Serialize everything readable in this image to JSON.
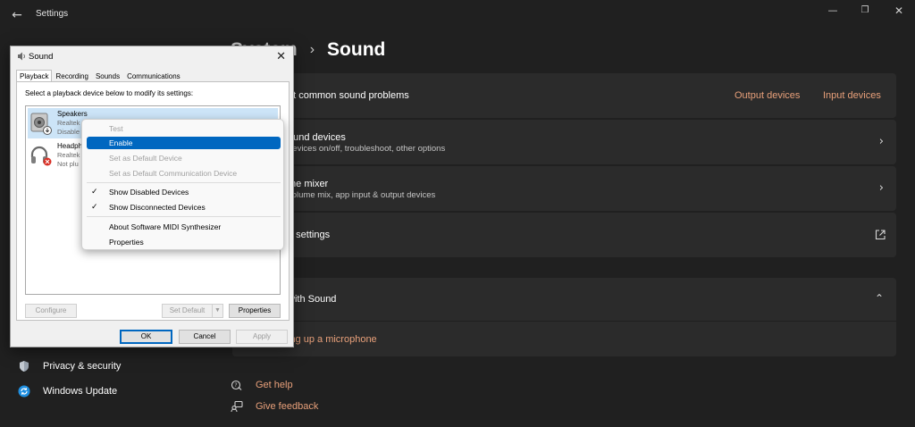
{
  "settings": {
    "app_title": "Settings",
    "breadcrumb": {
      "parent": "System",
      "separator": "›",
      "current": "Sound"
    },
    "cards": {
      "troubleshoot": {
        "title": "ot common sound problems",
        "link_output": "Output devices",
        "link_input": "Input devices"
      },
      "all_devices": {
        "title": "ound devices",
        "subtitle": "devices on/off, troubleshoot, other options"
      },
      "mixer": {
        "title": "me mixer",
        "subtitle": "volume mix, app input & output devices"
      },
      "more": {
        "title": "d settings"
      },
      "help_section": {
        "title": "with Sound",
        "link": "ing up a microphone"
      }
    },
    "sidebar": [
      {
        "label": "Privacy & security",
        "icon": "shield-icon"
      },
      {
        "label": "Windows Update",
        "icon": "windows-update-icon"
      }
    ],
    "help_links": [
      {
        "label": "Get help",
        "icon": "help-icon"
      },
      {
        "label": "Give feedback",
        "icon": "feedback-icon"
      }
    ]
  },
  "dialog": {
    "title": "Sound",
    "tabs": [
      "Playback",
      "Recording",
      "Sounds",
      "Communications"
    ],
    "active_tab": "Playback",
    "instruction": "Select a playback device below to modify its settings:",
    "devices": [
      {
        "name": "Speakers",
        "line1": "Realtek",
        "line2": "Disable"
      },
      {
        "name": "Headph",
        "line1": "Realtek",
        "line2": "Not plu"
      }
    ],
    "buttons": {
      "configure": "Configure",
      "set_default": "Set Default",
      "properties": "Properties",
      "ok": "OK",
      "cancel": "Cancel",
      "apply": "Apply"
    }
  },
  "context_menu": {
    "items": [
      {
        "label": "Test",
        "state": "disabled"
      },
      {
        "label": "Enable",
        "state": "highlight"
      },
      {
        "label": "Set as Default Device",
        "state": "disabled"
      },
      {
        "label": "Set as Default Communication Device",
        "state": "disabled"
      },
      {
        "label": "Show Disabled Devices",
        "state": "checked"
      },
      {
        "label": "Show Disconnected Devices",
        "state": "checked"
      },
      {
        "label": "About Software MIDI Synthesizer",
        "state": "normal"
      },
      {
        "label": "Properties",
        "state": "normal"
      }
    ]
  },
  "colors": {
    "background": "#202020",
    "card": "#2b2b2b",
    "accent_link": "#e8a07a",
    "menu_highlight": "#0067c0"
  }
}
